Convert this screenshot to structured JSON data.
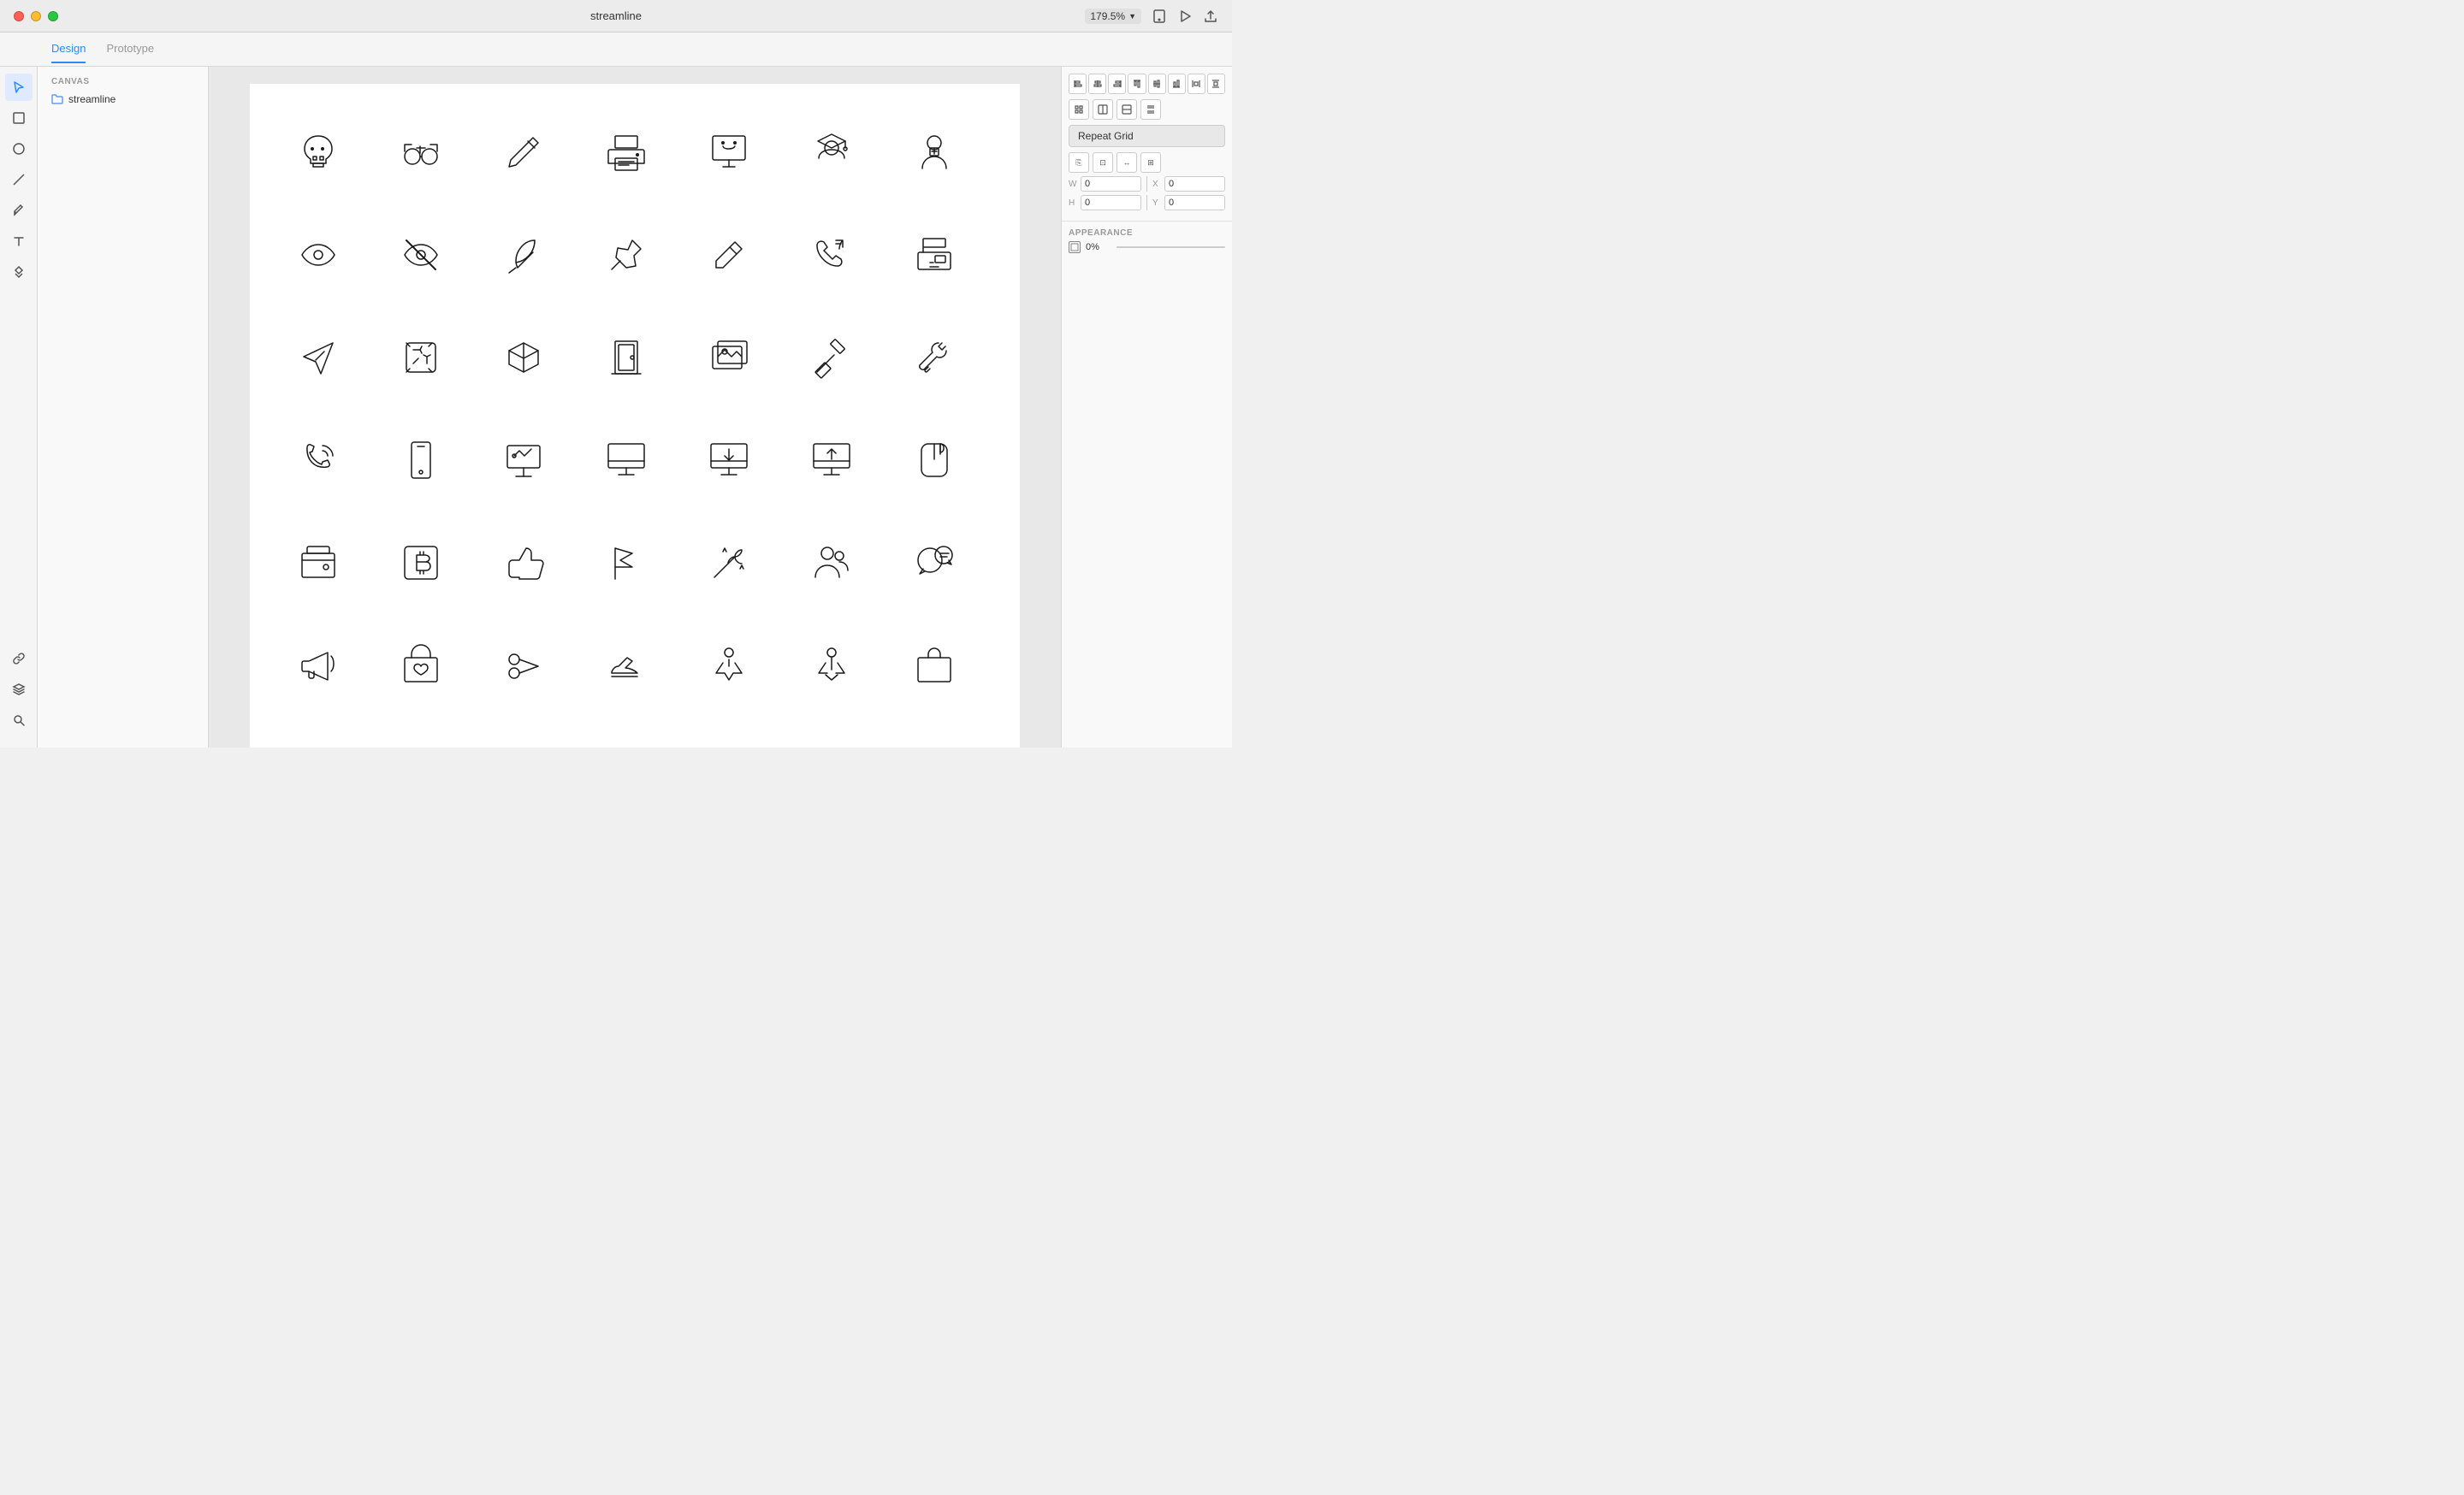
{
  "titleBar": {
    "appName": "streamline",
    "zoom": "179.5%"
  },
  "tabs": [
    {
      "label": "Design",
      "active": true
    },
    {
      "label": "Prototype",
      "active": false
    }
  ],
  "canvas": {
    "label": "CANVAS",
    "items": [
      {
        "name": "streamline"
      }
    ]
  },
  "rightPanel": {
    "repeatGridLabel": "Repeat Grid",
    "width": {
      "label": "W",
      "value": "0"
    },
    "height": {
      "label": "H",
      "value": "0"
    },
    "x": {
      "label": "X",
      "value": "0"
    },
    "y": {
      "label": "Y",
      "value": "0"
    },
    "appearance": "APPEARANCE",
    "opacity": "0%"
  },
  "toolbar": {
    "select": "▲",
    "rectangle": "□",
    "ellipse": "○",
    "line": "/",
    "pen": "✏",
    "text": "T",
    "component": "⊕",
    "search": "⌕"
  }
}
